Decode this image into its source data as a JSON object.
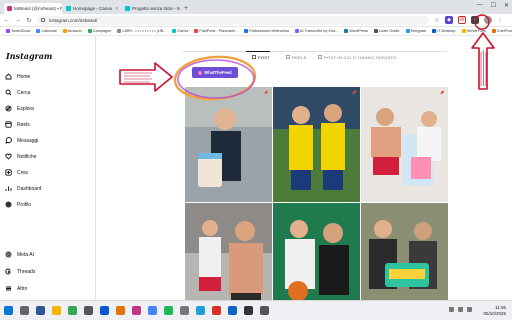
{
  "browser": {
    "tabs": [
      {
        "label": "MrBeast (@mrbeast) • Foto e v...",
        "color": "#c13584",
        "active": true
      },
      {
        "label": "Homepage - Canva",
        "color": "#00c4cc",
        "active": false
      },
      {
        "label": "Progetto senza titolo - Mocku...",
        "color": "#00c4cc",
        "active": false
      }
    ],
    "new_tab": "+",
    "url": "instagram.com/mrbeast/",
    "bookmarks": [
      {
        "label": "TwitchDocs",
        "color": "#9146ff"
      },
      {
        "label": "Calendar",
        "color": "#4285f4"
      },
      {
        "label": "Amazon",
        "color": "#ff9900"
      },
      {
        "label": "Campagne",
        "color": "#34a853"
      },
      {
        "label": "LIBRI - • • • • • • • • • (UB...",
        "color": "#888888"
      },
      {
        "label": "Canva",
        "color": "#00c4cc"
      },
      {
        "label": "FastPods - Panorami...",
        "color": "#ea4335"
      },
      {
        "label": "Fatturazione elettronica",
        "color": "#1a73e8"
      },
      {
        "label": "AI Transcribe by Sna...",
        "color": "#7b61ff"
      },
      {
        "label": "WordPress",
        "color": "#21759b"
      },
      {
        "label": "Lister Guide",
        "color": "#555555"
      },
      {
        "label": "Telegram",
        "color": "#229ed9"
      },
      {
        "label": "IT-Desktop",
        "color": "#0b57d0"
      },
      {
        "label": "ServerFiles",
        "color": "#f4b400"
      },
      {
        "label": "CoinProduct...",
        "color": "#e37400"
      }
    ]
  },
  "instagram": {
    "logo": "Instagram",
    "nav": [
      {
        "label": "Home",
        "icon": "home-icon"
      },
      {
        "label": "Cerca",
        "icon": "search-icon"
      },
      {
        "label": "Esplora",
        "icon": "compass-icon"
      },
      {
        "label": "Reels",
        "icon": "reels-icon"
      },
      {
        "label": "Messaggi",
        "icon": "messenger-icon"
      },
      {
        "label": "Notifiche",
        "icon": "heart-icon"
      },
      {
        "label": "Crea",
        "icon": "plus-square-icon"
      },
      {
        "label": "Dashboard",
        "icon": "dashboard-icon"
      },
      {
        "label": "Profilo",
        "icon": "avatar-icon"
      }
    ],
    "bottom_nav": [
      {
        "label": "Meta AI",
        "icon": "meta-ai-icon"
      },
      {
        "label": "Threads",
        "icon": "threads-icon"
      },
      {
        "label": "Altro",
        "icon": "menu-icon"
      }
    ],
    "profile_tabs": [
      {
        "label": "POST",
        "active": true
      },
      {
        "label": "REELS",
        "active": false
      },
      {
        "label": "POST IN CUI TI HANNO TAGGATO",
        "active": false
      }
    ],
    "extension_button": "WhatTheFeed",
    "grid_tiles": [
      {
        "name": "post-1",
        "bg": "#9aa3a8",
        "pinned": true
      },
      {
        "name": "post-2",
        "bg": "#4d7c3a",
        "pinned": true
      },
      {
        "name": "post-3",
        "bg": "#e9e6e2",
        "pinned": true
      },
      {
        "name": "post-4",
        "bg": "#b7b5b1",
        "pinned": false
      },
      {
        "name": "post-5",
        "bg": "#1f7a4d",
        "pinned": false
      },
      {
        "name": "post-6",
        "bg": "#8a8f73",
        "pinned": false
      }
    ]
  },
  "taskbar": {
    "time": "11:06",
    "date": "05/10/2025"
  }
}
